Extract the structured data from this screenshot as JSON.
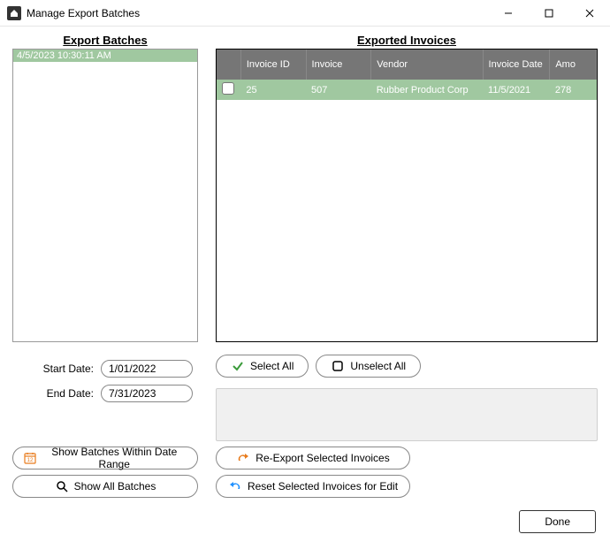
{
  "window": {
    "title": "Manage Export Batches"
  },
  "left": {
    "title": "Export Batches",
    "batches": [
      {
        "label": "4/5/2023 10:30:11 AM"
      }
    ],
    "start_date_label": "Start Date:",
    "end_date_label": "End Date:",
    "start_date_value": "1/01/2022",
    "end_date_value": "7/31/2023",
    "show_within_label": "Show Batches Within Date Range",
    "show_all_label": "Show All Batches"
  },
  "right": {
    "title": "Exported Invoices",
    "headers": {
      "invoice_id": "Invoice ID",
      "invoice": "Invoice",
      "vendor": "Vendor",
      "invoice_date": "Invoice Date",
      "amount": "Amo"
    },
    "rows": [
      {
        "invoice_id": "25",
        "invoice": "507",
        "vendor": "Rubber Product Corp",
        "invoice_date": "11/5/2021",
        "amount": "278"
      }
    ],
    "select_all_label": "Select All",
    "unselect_all_label": "Unselect All",
    "reexport_label": "Re-Export Selected Invoices",
    "reset_label": "Reset Selected Invoices for Edit"
  },
  "footer": {
    "done_label": "Done"
  }
}
